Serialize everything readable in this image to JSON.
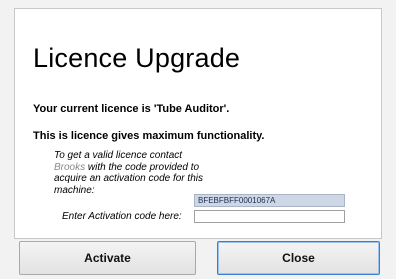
{
  "dialog": {
    "title": "Licence Upgrade",
    "current_licence": "Your current licence is 'Tube Auditor'.",
    "functionality": "This is licence gives maximum functionality.",
    "instructions": {
      "part1": "To get a valid licence contact",
      "part2": "Brooks",
      "part3": "with the code provided to acquire an activation code for this machine:"
    },
    "machine_code": "BFEBFBFF0001067A",
    "activation_label": "Enter Activation code here:",
    "activation_value": ""
  },
  "buttons": {
    "activate": "Activate",
    "close": "Close"
  }
}
